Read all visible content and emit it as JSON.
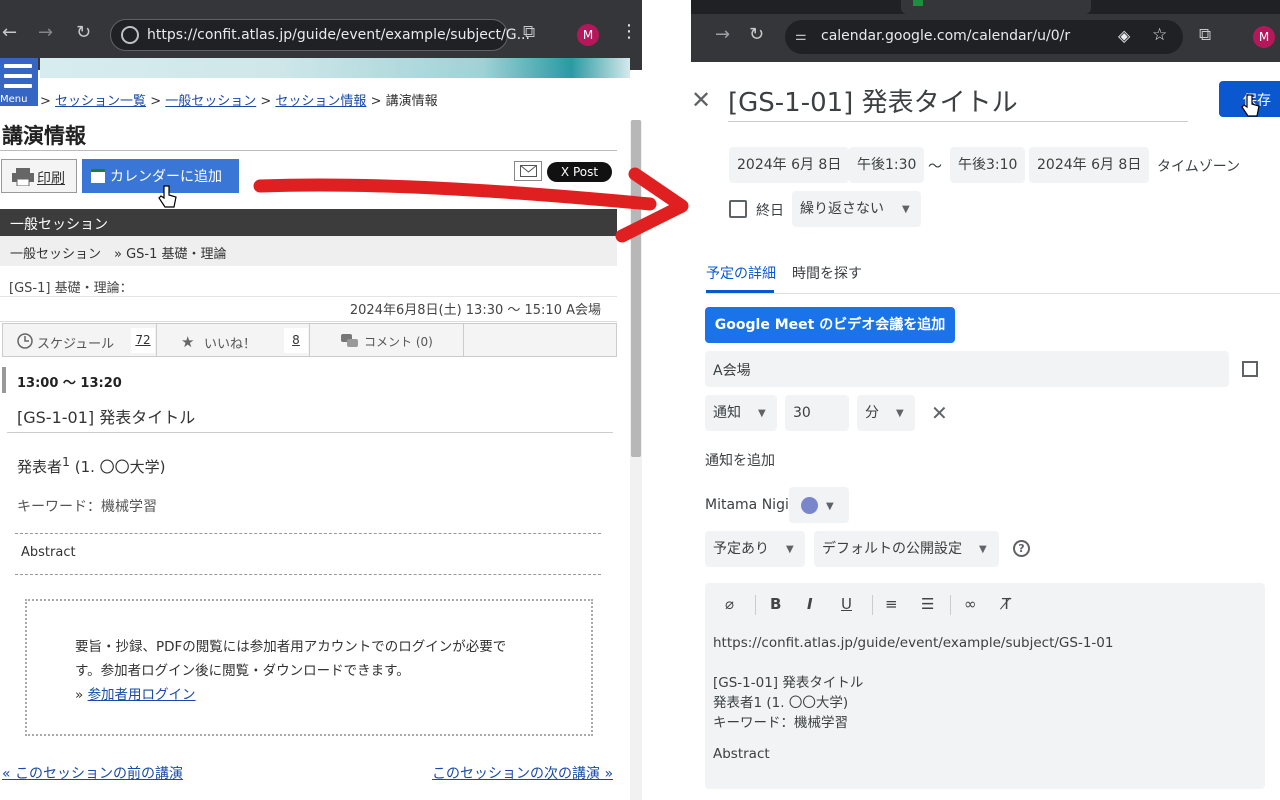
{
  "left": {
    "url": "https://confit.atlas.jp/guide/event/example/subject/G...",
    "menu_label": "Menu",
    "breadcrumb": [
      "セッション一覧",
      "一般セッション",
      "セッション情報"
    ],
    "breadcrumb_current": "講演情報",
    "heading": "講演情報",
    "print_label": "印刷",
    "calendar_label": "カレンダーに追加",
    "xpost_label": "X Post",
    "session_type": "一般セッション",
    "session_path": "一般セッション　» GS-1 基礎・理論",
    "session_name": "[GS-1] 基礎・理論：",
    "session_datetime": "2024年6月8日(土) 13:30 〜 15:10 A会場",
    "schedule_label": "スケジュール",
    "schedule_count": "72",
    "like_label": "いいね！",
    "like_count": "8",
    "comment_label": "コメント (0)",
    "time": "13:00 〜 13:20",
    "title": "[GS-1-01] 発表タイトル",
    "presenter_name": "発表者",
    "presenter_sup": "1",
    "presenter_aff": " (1. 〇〇大学)",
    "keywords": "キーワード：機械学習",
    "abstract": "Abstract",
    "notice_1": "要旨・抄録、PDFの閲覧には参加者用アカウントでのログインが必要で",
    "notice_2": "す。参加者ログイン後に閲覧・ダウンロードできます。",
    "login_prefix": "» ",
    "login_link": "参加者用ログイン",
    "prev_link": "« このセッションの前の講演",
    "next_link": "このセッションの次の講演 »",
    "avatar": "M"
  },
  "right": {
    "url": "calendar.google.com/calendar/u/0/r",
    "avatar": "M",
    "title": "[GS-1-01] 発表タイトル",
    "save_label": "保存",
    "start_date": "2024年 6月 8日",
    "start_time": "午後1:30",
    "tilde": "〜",
    "end_time": "午後3:10",
    "end_date": "2024年 6月 8日",
    "timezone": "タイムゾーン",
    "allday_label": "終日",
    "repeat": "繰り返さない",
    "tab_details": "予定の詳細",
    "tab_find_time": "時間を探す",
    "meet_button": "Google Meet のビデオ会議を追加",
    "location": "A会場",
    "notify_type": "通知",
    "notify_value": "30",
    "notify_unit": "分",
    "add_notification": "通知を追加",
    "owner": "Mitama Nigi",
    "busy": "予定あり",
    "visibility": "デフォルトの公開設定",
    "help": "?",
    "desc_url": "https://confit.atlas.jp/guide/event/example/subject/GS-1-01",
    "desc_title": "[GS-1-01] 発表タイトル",
    "desc_presenter": "発表者1 (1. 〇〇大学)",
    "desc_keywords": "キーワード：機械学習",
    "desc_abstract": "Abstract",
    "accent_color": "#0b57d0",
    "event_color": "#7986cb"
  }
}
